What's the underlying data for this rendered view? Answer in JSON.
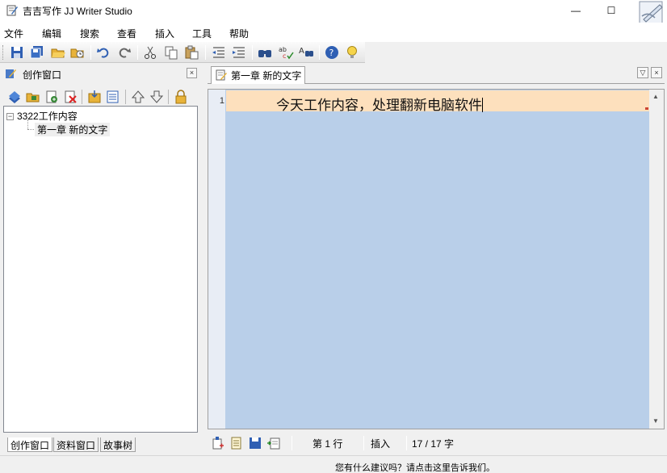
{
  "window": {
    "title": "吉吉写作 JJ Writer Studio",
    "minimize_glyph": "—",
    "maximize_glyph": "☐"
  },
  "menu": [
    "文件",
    "编辑",
    "搜索",
    "查看",
    "插入",
    "工具",
    "帮助"
  ],
  "toolbar_icons": [
    "save-icon",
    "save-all-icon",
    "open-folder-icon",
    "recent-folder-icon",
    "undo-icon",
    "redo-icon",
    "cut-icon",
    "copy-icon",
    "paste-icon",
    "outdent-icon",
    "indent-icon",
    "find-icon",
    "spellcheck-icon",
    "replace-icon",
    "help-icon",
    "tip-icon"
  ],
  "left_panel": {
    "title": "创作窗口",
    "close_glyph": "×",
    "toolbar_icons": [
      "add-book-icon",
      "add-folder-icon",
      "add-chapter-icon",
      "delete-icon",
      "import-icon",
      "properties-icon",
      "move-up-icon",
      "move-down-icon",
      "lock-icon"
    ],
    "tree": {
      "expander": "−",
      "root": "3322工作内容",
      "child": "第一章 新的文字"
    },
    "tabs": [
      "创作窗口",
      "资料窗口",
      "故事树"
    ]
  },
  "document": {
    "tab_title": "第一章 新的文字",
    "tab_menu_glyph": "▽",
    "tab_close_glyph": "×",
    "line_number": "1",
    "line_text": "今天工作内容，处理翻新电脑软件",
    "scroll_up_glyph": "▲",
    "scroll_down_glyph": "▼"
  },
  "statusbar": {
    "line": "第 1 行",
    "mode": "插入",
    "count": "17 / 17 字"
  },
  "feedback": "您有什么建议吗？请点击这里告诉我们。",
  "colors": {
    "editor_bg": "#b9cfe9",
    "current_line_bg": "#fde0bd"
  }
}
